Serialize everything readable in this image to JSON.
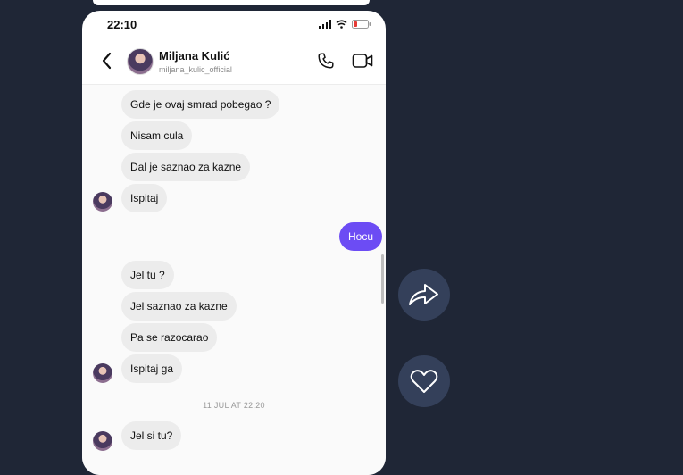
{
  "status_bar": {
    "time": "22:10"
  },
  "header": {
    "contact_name": "Miljana Kulić",
    "contact_handle": "miljana_kulic_official"
  },
  "messages": [
    {
      "text": "Gde je ovaj smrad pobegao ?",
      "direction": "in"
    },
    {
      "text": "Nisam cula",
      "direction": "in"
    },
    {
      "text": "Dal je saznao za kazne",
      "direction": "in"
    },
    {
      "text": "Ispitaj",
      "direction": "in"
    },
    {
      "text": "Hocu",
      "direction": "out"
    },
    {
      "text": "Jel tu ?",
      "direction": "in"
    },
    {
      "text": "Jel saznao za kazne",
      "direction": "in"
    },
    {
      "text": "Pa se razocarao",
      "direction": "in"
    },
    {
      "text": "Ispitaj ga",
      "direction": "in"
    },
    {
      "text": "Jel si tu?",
      "direction": "in"
    }
  ],
  "timestamp": "11 JUL AT 22:20",
  "actions": {
    "share_icon": "share-icon",
    "like_icon": "heart-icon"
  },
  "colors": {
    "background": "#1f2636",
    "outgoing_bubble": "#6c4cf4",
    "incoming_bubble": "#ececec",
    "action_button": "#34405a"
  }
}
